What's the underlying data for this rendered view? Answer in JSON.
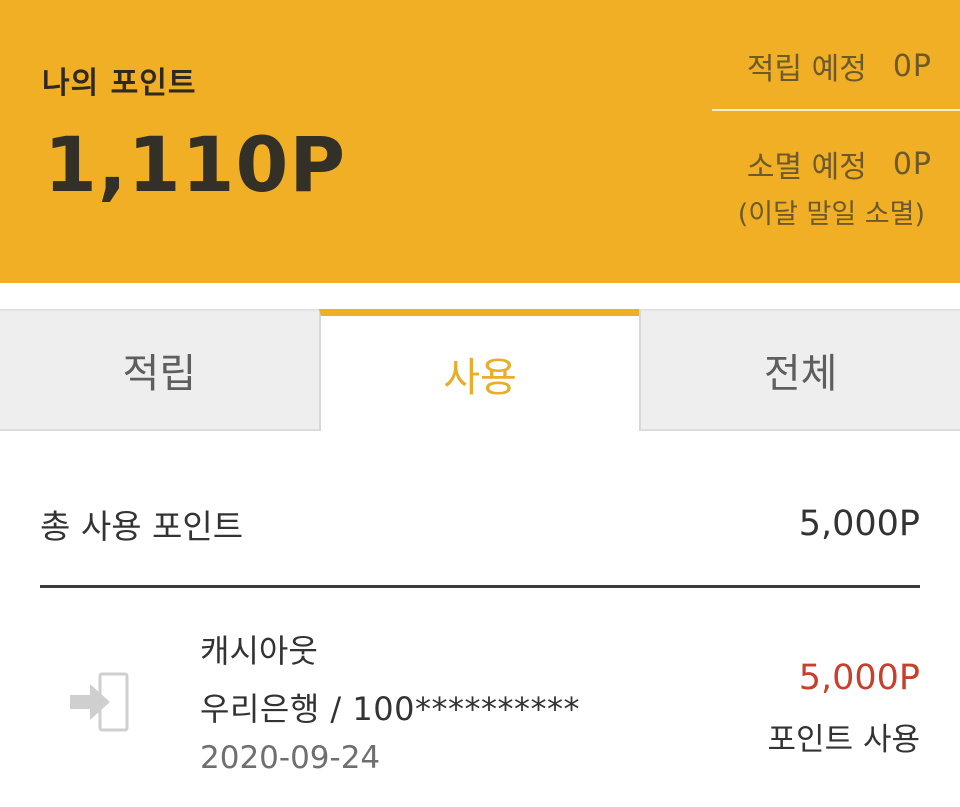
{
  "header": {
    "my_points_label": "나의 포인트",
    "my_points_value": "1,110P",
    "earn_scheduled_label": "적립 예정",
    "earn_scheduled_value": "0P",
    "expire_scheduled_label": "소멸 예정",
    "expire_scheduled_value": "0P",
    "expire_note": "(이달 말일 소멸)"
  },
  "tabs": [
    {
      "label": "적립",
      "active": false
    },
    {
      "label": "사용",
      "active": true
    },
    {
      "label": "전체",
      "active": false
    }
  ],
  "summary": {
    "total_label": "총 사용 포인트",
    "total_value": "5,000P"
  },
  "history": [
    {
      "icon": "cashout-icon",
      "title": "캐시아웃",
      "account": "우리은행 / 100**********",
      "date": "2020-09-24",
      "amount": "5,000P",
      "type": "포인트 사용"
    }
  ],
  "colors": {
    "header_bg": "#F0AF25",
    "active_tab": "#E8AE27",
    "amount_red": "#C8402C"
  }
}
